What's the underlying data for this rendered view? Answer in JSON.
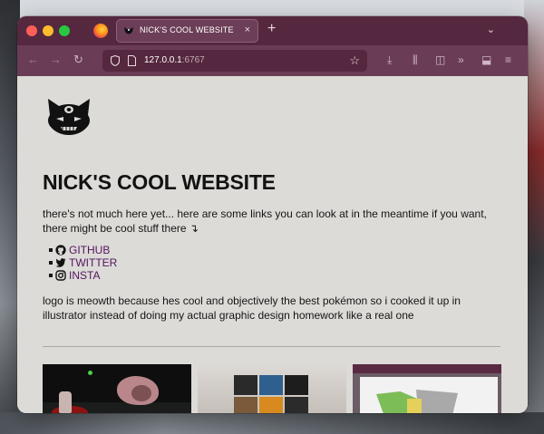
{
  "browser": {
    "tab_title": "NICK'S COOL WEBSITE",
    "tab_close": "×",
    "new_tab": "+",
    "tabs_menu": "⌄",
    "url_host": "127.0.0.1",
    "url_port": ":6767",
    "nav": {
      "back": "←",
      "forward": "→",
      "reload": "↻"
    },
    "toolbar": {
      "bookmark": "☆",
      "downloads": "⤓",
      "library": "⫼",
      "sidebar": "◫",
      "more": "»",
      "extensions": "⬓",
      "menu": "≡"
    }
  },
  "page": {
    "title": "NICK'S COOL WEBSITE",
    "intro": "there's not much here yet... here are some links you can look at in the meantime if you want, there might be cool stuff there ↴",
    "links": [
      {
        "label": "GITHUB",
        "icon": "github-icon"
      },
      {
        "label": "TWITTER",
        "icon": "twitter-icon"
      },
      {
        "label": "INSTA",
        "icon": "instagram-icon"
      }
    ],
    "blurb": "logo is meowth because hes cool and objectively the best pokémon so i cooked it up in illustrator instead of doing my actual graphic design homework like a real one"
  },
  "colors": {
    "titlebar": "#55283f",
    "navbar": "#6b3c55",
    "page_bg": "#dcdbd7",
    "link": "#54135f"
  }
}
